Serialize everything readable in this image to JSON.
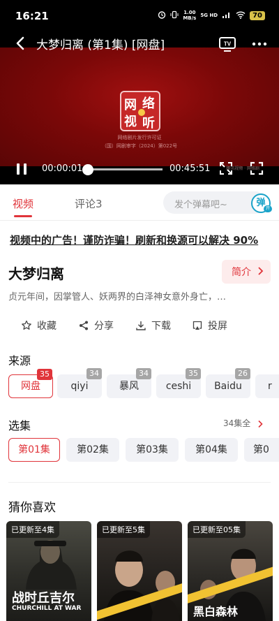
{
  "status_bar": {
    "time": "16:21",
    "net_speed": "1.00",
    "net_unit": "MB/s",
    "signal": "5G HD",
    "battery": "70"
  },
  "player": {
    "title": "大梦归离 (第1集) [网盘]",
    "current_time": "00:00:01",
    "total_time": "00:45:51",
    "progress": 0.0004,
    "seal_text": [
      "网",
      "络",
      "视",
      "听"
    ],
    "watermark_lines": [
      "网络剧片发行许可证",
      "（国）网剧审字（2024）第022号"
    ],
    "watermark_right": "腾讯视频 · 网络剧"
  },
  "tabs": {
    "video": "视频",
    "comments": "评论3"
  },
  "danmaku": {
    "placeholder": "发个弹幕吧~",
    "button": "弹",
    "toggle": "开"
  },
  "notice": "视频中的广告！谨防诈骗！刷新和换源可以解决 90%",
  "show": {
    "title": "大梦归离",
    "intro_button": "简介",
    "description": "贞元年间，因掌管人、妖两界的白泽神女意外身亡，…"
  },
  "actions": [
    "收藏",
    "分享",
    "下载",
    "投屏"
  ],
  "sources": {
    "title": "来源",
    "items": [
      {
        "label": "网盘",
        "count": "35",
        "selected": true
      },
      {
        "label": "qiyi",
        "count": "34",
        "selected": false
      },
      {
        "label": "暴风",
        "count": "34",
        "selected": false
      },
      {
        "label": "ceshi",
        "count": "35",
        "selected": false
      },
      {
        "label": "Baidu",
        "count": "26",
        "selected": false
      },
      {
        "label": "r",
        "count": "",
        "selected": false
      }
    ]
  },
  "episodes": {
    "title": "选集",
    "count_label": "34集全",
    "items": [
      "第01集",
      "第02集",
      "第03集",
      "第04集",
      "第0"
    ]
  },
  "recommend": {
    "title": "猜你喜欢",
    "cards": [
      {
        "badge": "已更新至4集",
        "overlay_title": "战时丘吉尔",
        "overlay_sub": "CHURCHILL AT WAR",
        "color": "#3a3a34"
      },
      {
        "badge": "已更新至5集",
        "overlay_title": "",
        "overlay_sub": "",
        "color": "#2a2623"
      },
      {
        "badge": "已更新至05集",
        "overlay_title": "黑白森林",
        "overlay_sub": "",
        "color": "#33312c"
      }
    ]
  },
  "colors": {
    "accent": "#e0343a",
    "danmaku": "#1aa3c9"
  }
}
